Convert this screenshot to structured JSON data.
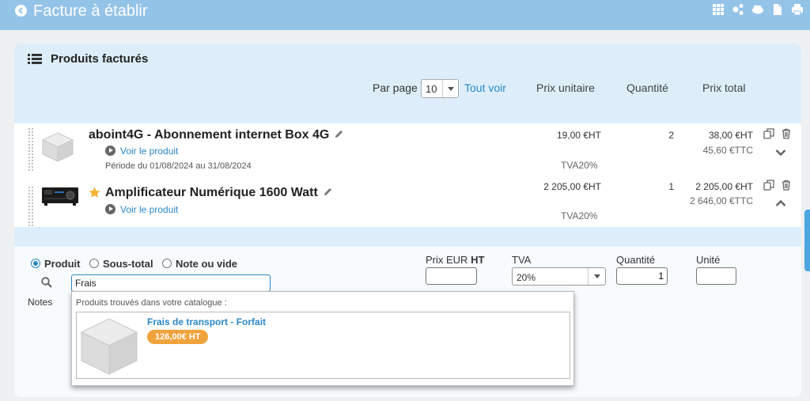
{
  "header": {
    "title": "Facture à établir",
    "icons": [
      "grid-icon",
      "share-icon",
      "cloud-icon",
      "document-icon",
      "print-icon"
    ]
  },
  "section": {
    "title": "Produits facturés"
  },
  "table": {
    "per_page_label": "Par page",
    "per_page_value": "10",
    "see_all": "Tout voir",
    "columns": {
      "unit_price": "Prix unitaire",
      "quantity": "Quantité",
      "total": "Prix total"
    }
  },
  "products": [
    {
      "name": "aboint4G - Abonnement internet Box 4G",
      "link": "Voir le produit",
      "period": "Période du 01/08/2024 au 31/08/2024",
      "unit_price": "19,00 €HT",
      "tva": "TVA20%",
      "quantity": "2",
      "total_ht": "38,00 €HT",
      "total_ttc": "45,60 €TTC"
    },
    {
      "name": "Amplificateur Numérique 1600 Watt",
      "link": "Voir le produit",
      "unit_price": "2 205,00 €HT",
      "tva": "TVA20%",
      "quantity": "1",
      "total_ht": "2 205,00 €HT",
      "total_ttc": "2 646,00 €TTC"
    }
  ],
  "form": {
    "radio_product": "Produit",
    "radio_subtotal": "Sous-total",
    "radio_note": "Note ou vide",
    "search_value": "Frais",
    "notes_label": "Notes",
    "price_label_prefix": "Prix EUR ",
    "price_label_suffix": "HT",
    "price_value": "",
    "tva_label": "TVA",
    "tva_value": "20%",
    "quantity_label": "Quantité",
    "quantity_value": "1",
    "unit_label": "Unité",
    "unit_value": ""
  },
  "dropdown": {
    "header": "Produits trouvés dans votre catalogue :",
    "items": [
      {
        "name": "Frais de transport - Forfait",
        "price": "126,00€ HT"
      }
    ]
  },
  "colors": {
    "topbar": "#94c3e8",
    "accent": "#2a87c8",
    "badge": "#f0a23c"
  }
}
